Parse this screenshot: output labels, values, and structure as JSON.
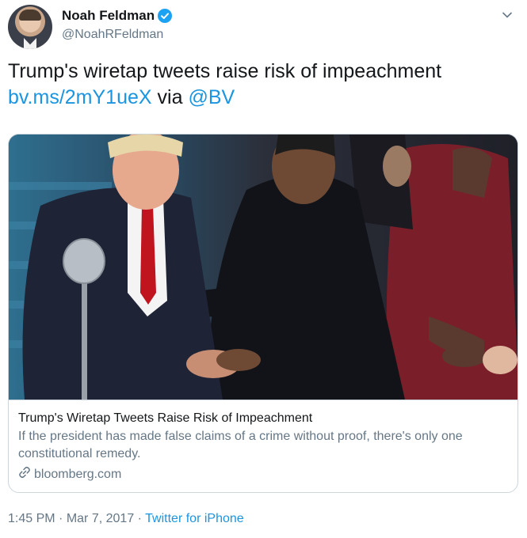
{
  "author": {
    "display_name": "Noah Feldman",
    "handle": "@NoahRFeldman",
    "verified": true
  },
  "tweet": {
    "text": "Trump's wiretap tweets raise risk of impeachment",
    "link_text": "bv.ms/2mY1ueX",
    "via_text": "via",
    "mention": "@BV"
  },
  "card": {
    "title": "Trump's Wiretap Tweets Raise Risk of Impeachment",
    "description": "If the president has made false claims of a crime without proof, there's only one constitutional remedy.",
    "domain": "bloomberg.com"
  },
  "meta": {
    "time": "1:45 PM",
    "separator": "·",
    "date": "Mar 7, 2017",
    "source": "Twitter for iPhone"
  },
  "colors": {
    "link": "#1b95e0",
    "secondary_text": "#657786",
    "verified_badge": "#1da1f2"
  },
  "icons": [
    "verified-badge-icon",
    "chevron-down-icon",
    "link-icon"
  ]
}
